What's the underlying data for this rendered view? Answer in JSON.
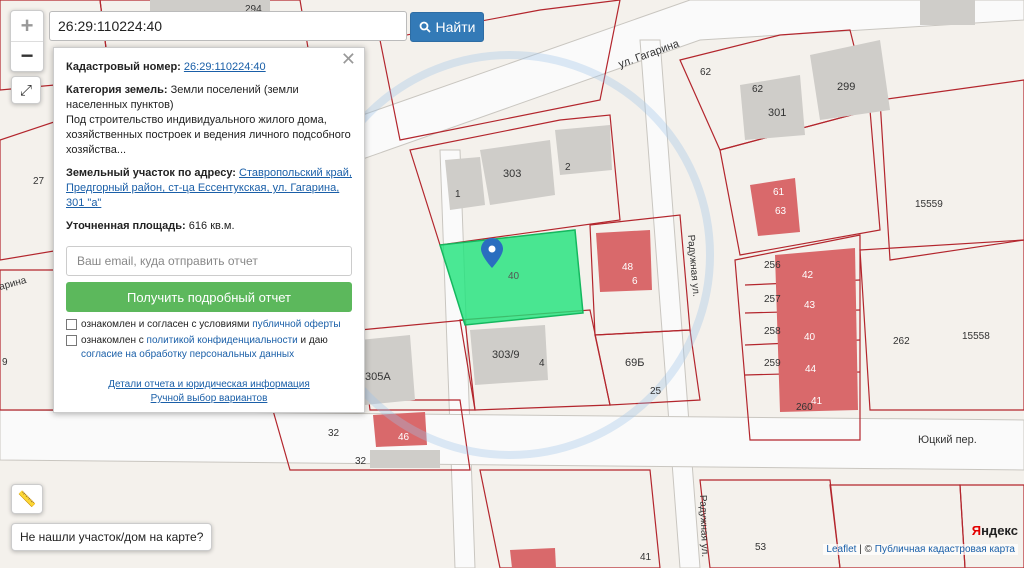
{
  "search": {
    "value": "26:29:110224:40",
    "button_label": "Найти"
  },
  "zoom": {
    "in": "+",
    "out": "−"
  },
  "panel": {
    "cad_label": "Кадастровый номер:",
    "cad_value": "26:29:110224:40",
    "category_label": "Категория земель:",
    "category_value": "Земли поселений (земли населенных пунктов)",
    "usage": "Под строительство индивидуального жилого дома, хозяйственных построек и ведения личного подсобного хозяйства...",
    "address_label": "Земельный участок по адресу:",
    "address_value": "Ставропольский край, Предгорный район, ст-ца Ессентукская, ул. Гагарина, 301 \"а\"",
    "area_label": "Уточненная площадь:",
    "area_value": "616 кв.м.",
    "email_placeholder": "Ваш email, куда отправить отчет",
    "report_button": "Получить подробный отчет",
    "consent1_text": "ознакомлен и согласен с условиями",
    "consent1_link": "публичной оферты",
    "consent2_text": "ознакомлен с",
    "consent2_link": "политикой конфиденциальности",
    "consent2_tail": "и даю",
    "consent2_link2": "согласие на обработку персональных данных",
    "details_link": "Детали отчета и юридическая информация",
    "manual_link": "Ручной выбор вариантов"
  },
  "not_found_label": "Не нашли участок/дом на карте?",
  "attribution": {
    "leaflet": "Leaflet",
    "sep": "| ©",
    "source": "Публичная кадастровая карта"
  },
  "yandex": {
    "first": "Я",
    "rest": "ндекс"
  },
  "map_labels": {
    "street_gagarina": "ул. Гагарина",
    "street_raduzhnaya": "Радужная ул.",
    "street_yutsky": "Юцкий пер.",
    "street_raduzhnaya2": "Радужная ул.",
    "street_left": "арина",
    "n294": "294",
    "n62a": "62",
    "n62b": "62",
    "n299": "299",
    "n301": "301",
    "n303": "303",
    "n2": "2",
    "n1": "1",
    "n27": "27",
    "n15559": "15559",
    "n61": "61",
    "n63": "63",
    "n48": "48",
    "n6": "6",
    "n40": "40",
    "n256": "256",
    "n42": "42",
    "n257": "257",
    "n43": "43",
    "n258": "258",
    "n40b": "40",
    "n259": "259",
    "n44": "44",
    "n260": "260",
    "n41": "41",
    "n262": "262",
    "n15558": "15558",
    "n303_9": "303/9",
    "n4": "4",
    "n69b": "69Б",
    "n25": "25",
    "n305a": "305А",
    "n32": "32",
    "n46": "46",
    "n32b": "32",
    "n9": "9",
    "n53": "53",
    "n41b": "41"
  },
  "colors": {
    "parcel_selected": "#1ee37a",
    "parcel_border": "#b3262d",
    "building": "#d9696b",
    "marker": "#2a6ebf"
  }
}
